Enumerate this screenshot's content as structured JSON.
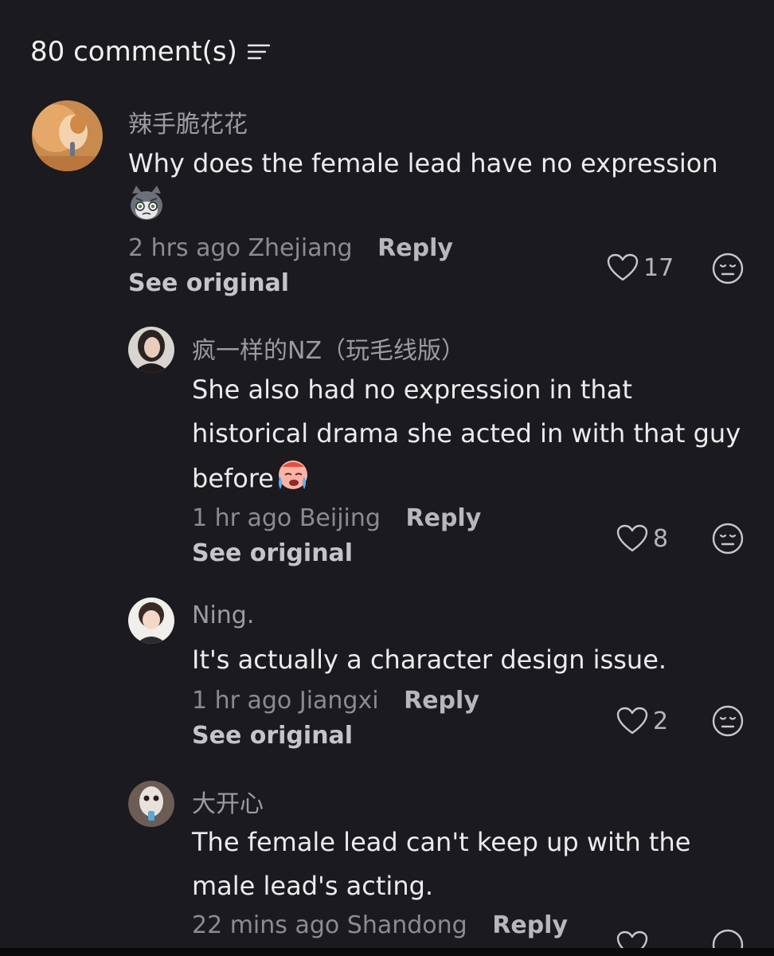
{
  "header": {
    "comment_count_label": "80 comment(s)",
    "sort_icon": "sort-lines-icon"
  },
  "comments": [
    {
      "username": "辣手脆花花",
      "text": "Why does the female lead have no expression",
      "emoji": "grumpy-cat-icon",
      "time": "2 hrs ago",
      "location": "Zhejiang",
      "reply_label": "Reply",
      "see_original_label": "See original",
      "likes": "17"
    },
    {
      "username": "疯一样的NZ（玩毛线版）",
      "text_line1": "She also had no expression in that",
      "text_line2": "historical drama she acted in with that guy",
      "text_line3": "before",
      "emoji": "crying-face-icon",
      "time": "1 hr ago",
      "location": "Beijing",
      "reply_label": "Reply",
      "see_original_label": "See original",
      "likes": "8"
    },
    {
      "username": "Ning.",
      "text": "It's actually a character design issue.",
      "time": "1 hr ago",
      "location": "Jiangxi",
      "reply_label": "Reply",
      "see_original_label": "See original",
      "likes": "2"
    },
    {
      "username": "大开心",
      "text_line1": "The female lead can't keep up with the",
      "text_line2": "male lead's acting.",
      "time": "22 mins ago",
      "location": "Shandong",
      "reply_label": "Reply"
    }
  ],
  "colors": {
    "background": "#1b1a1f",
    "text_primary": "#ececef",
    "text_secondary": "#8b8b92"
  }
}
